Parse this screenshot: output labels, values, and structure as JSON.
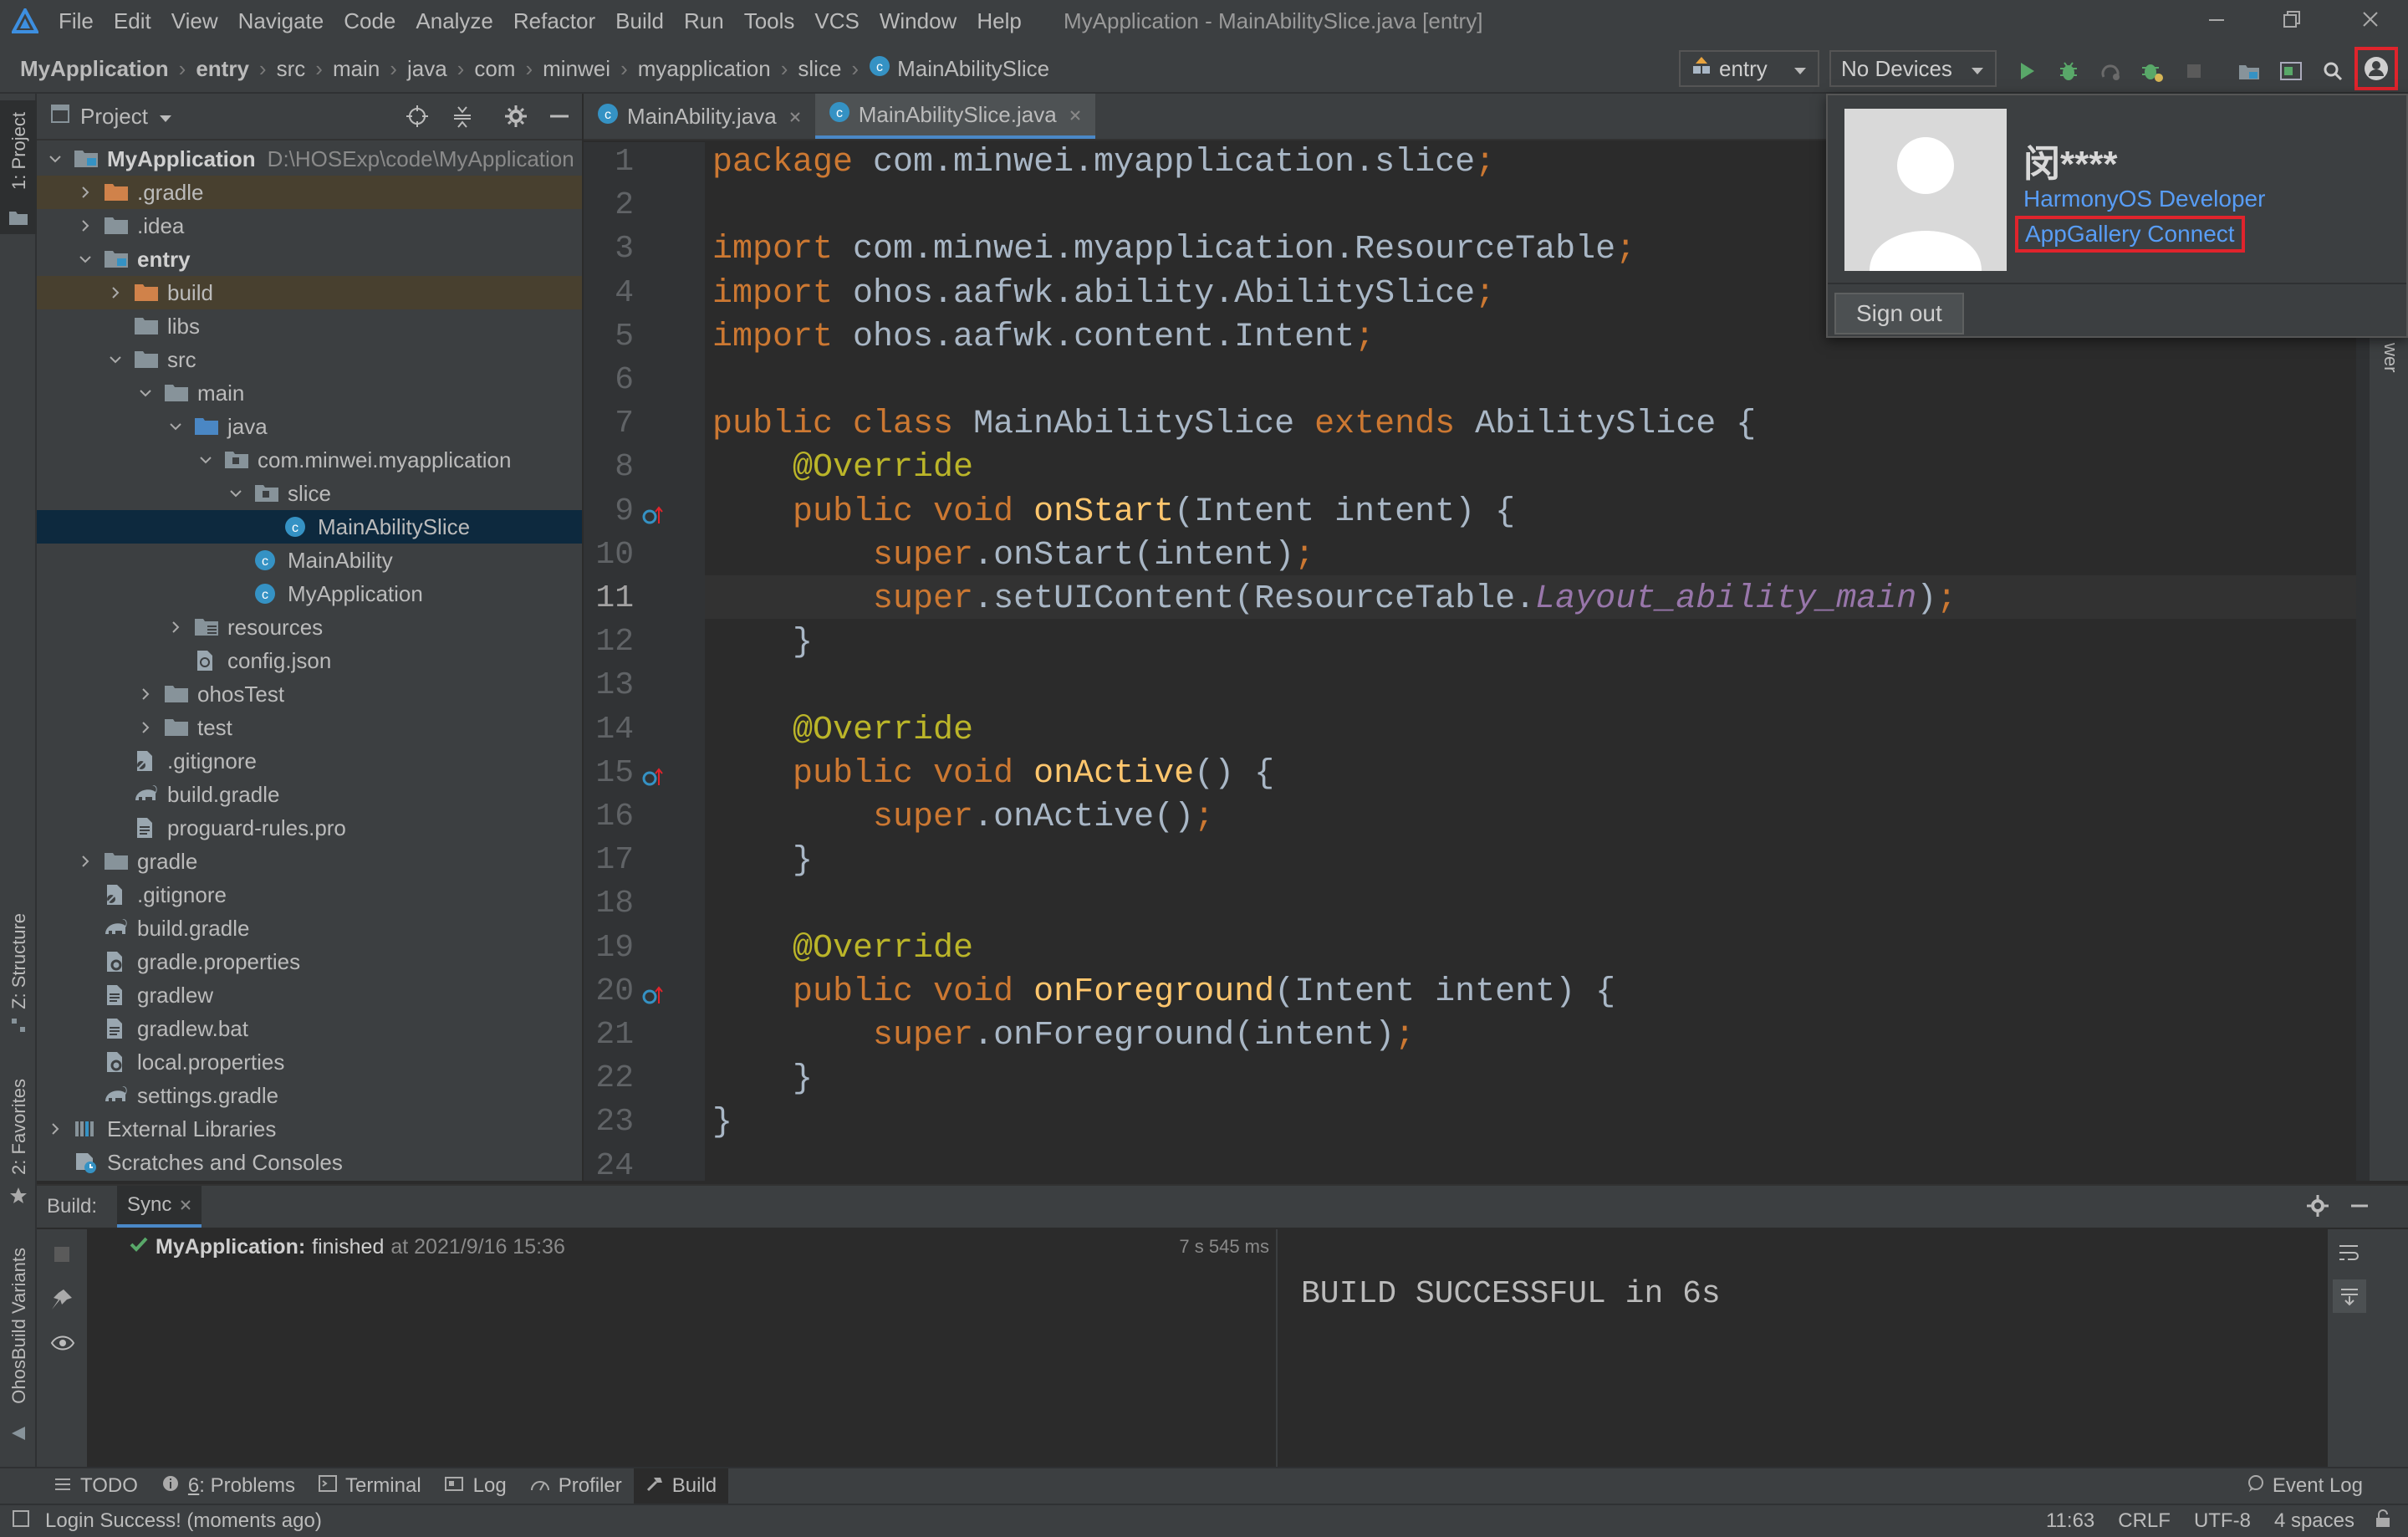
{
  "window": {
    "title": "MyApplication - MainAbilitySlice.java [entry]",
    "menu": [
      "File",
      "Edit",
      "View",
      "Navigate",
      "Code",
      "Analyze",
      "Refactor",
      "Build",
      "Run",
      "Tools",
      "VCS",
      "Window",
      "Help"
    ]
  },
  "breadcrumb": [
    "MyApplication",
    "entry",
    "src",
    "main",
    "java",
    "com",
    "minwei",
    "myapplication",
    "slice",
    "MainAbilitySlice"
  ],
  "toolbar": {
    "module": "entry",
    "device": "No Devices"
  },
  "side_tabs": {
    "project": "1: Project",
    "structure": "Z: Structure",
    "favorites": "2: Favorites",
    "variants": "OhosBuild Variants"
  },
  "project": {
    "title": "Project",
    "tree": [
      {
        "label": "MyApplication",
        "path": "D:\\HOSExp\\code\\MyApplication",
        "bold": true,
        "depth": 0,
        "arrow": "open",
        "icon": "module-folder-icon"
      },
      {
        "label": ".gradle",
        "depth": 1,
        "arrow": "closed",
        "icon": "excluded-folder-icon",
        "hl": true
      },
      {
        "label": ".idea",
        "depth": 1,
        "arrow": "closed",
        "icon": "folder-icon"
      },
      {
        "label": "entry",
        "bold": true,
        "depth": 1,
        "arrow": "open",
        "icon": "module-folder-icon"
      },
      {
        "label": "build",
        "depth": 2,
        "arrow": "closed",
        "icon": "excluded-folder-icon",
        "hl": true
      },
      {
        "label": "libs",
        "depth": 2,
        "arrow": "none",
        "icon": "folder-icon"
      },
      {
        "label": "src",
        "depth": 2,
        "arrow": "open",
        "icon": "folder-icon"
      },
      {
        "label": "main",
        "depth": 3,
        "arrow": "open",
        "icon": "folder-icon"
      },
      {
        "label": "java",
        "depth": 4,
        "arrow": "open",
        "icon": "source-folder-icon"
      },
      {
        "label": "com.minwei.myapplication",
        "depth": 5,
        "arrow": "open",
        "icon": "package-icon"
      },
      {
        "label": "slice",
        "depth": 6,
        "arrow": "open",
        "icon": "package-icon"
      },
      {
        "label": "MainAbilitySlice",
        "depth": 7,
        "arrow": "none",
        "icon": "java-class-icon",
        "sel": true
      },
      {
        "label": "MainAbility",
        "depth": 6,
        "arrow": "none",
        "icon": "java-class-icon"
      },
      {
        "label": "MyApplication",
        "depth": 6,
        "arrow": "none",
        "icon": "java-class-icon"
      },
      {
        "label": "resources",
        "depth": 4,
        "arrow": "closed",
        "icon": "resources-folder-icon"
      },
      {
        "label": "config.json",
        "depth": 4,
        "arrow": "none",
        "icon": "json-file-icon"
      },
      {
        "label": "ohosTest",
        "depth": 3,
        "arrow": "closed",
        "icon": "folder-icon"
      },
      {
        "label": "test",
        "depth": 3,
        "arrow": "closed",
        "icon": "folder-icon"
      },
      {
        "label": ".gitignore",
        "depth": 2,
        "arrow": "none",
        "icon": "gitignore-file-icon"
      },
      {
        "label": "build.gradle",
        "depth": 2,
        "arrow": "none",
        "icon": "gradle-file-icon"
      },
      {
        "label": "proguard-rules.pro",
        "depth": 2,
        "arrow": "none",
        "icon": "text-file-icon"
      },
      {
        "label": "gradle",
        "depth": 1,
        "arrow": "closed",
        "icon": "folder-icon"
      },
      {
        "label": ".gitignore",
        "depth": 1,
        "arrow": "none",
        "icon": "gitignore-file-icon"
      },
      {
        "label": "build.gradle",
        "depth": 1,
        "arrow": "none",
        "icon": "gradle-file-icon"
      },
      {
        "label": "gradle.properties",
        "depth": 1,
        "arrow": "none",
        "icon": "properties-file-icon"
      },
      {
        "label": "gradlew",
        "depth": 1,
        "arrow": "none",
        "icon": "text-file-icon"
      },
      {
        "label": "gradlew.bat",
        "depth": 1,
        "arrow": "none",
        "icon": "text-file-icon"
      },
      {
        "label": "local.properties",
        "depth": 1,
        "arrow": "none",
        "icon": "properties-file-icon"
      },
      {
        "label": "settings.gradle",
        "depth": 1,
        "arrow": "none",
        "icon": "gradle-file-icon"
      },
      {
        "label": "External Libraries",
        "depth": 0,
        "arrow": "closed",
        "icon": "libraries-icon"
      },
      {
        "label": "Scratches and Consoles",
        "depth": 0,
        "arrow": "none",
        "icon": "scratches-icon"
      }
    ]
  },
  "editor": {
    "tabs": [
      {
        "label": "MainAbility.java",
        "active": false
      },
      {
        "label": "MainAbilitySlice.java",
        "active": true
      }
    ],
    "lines": [
      [
        [
          "k",
          "package "
        ],
        [
          "t",
          "com.minwei.myapplication.slice"
        ],
        [
          "k",
          ";"
        ]
      ],
      [],
      [
        [
          "k",
          "import "
        ],
        [
          "t",
          "com.minwei.myapplication.ResourceTable"
        ],
        [
          "k",
          ";"
        ]
      ],
      [
        [
          "k",
          "import "
        ],
        [
          "t",
          "ohos.aafwk.ability.AbilitySlice"
        ],
        [
          "k",
          ";"
        ]
      ],
      [
        [
          "k",
          "import "
        ],
        [
          "t",
          "ohos.aafwk.content.Intent"
        ],
        [
          "k",
          ";"
        ]
      ],
      [],
      [
        [
          "k",
          "public class "
        ],
        [
          "t",
          "MainAbilitySlice "
        ],
        [
          "k",
          "extends "
        ],
        [
          "t",
          "AbilitySlice {"
        ]
      ],
      [
        [
          "t",
          "    "
        ],
        [
          "an",
          "@Override"
        ]
      ],
      [
        [
          "t",
          "    "
        ],
        [
          "k",
          "public void "
        ],
        [
          "fn",
          "onStart"
        ],
        [
          "t",
          "(Intent intent) {"
        ]
      ],
      [
        [
          "t",
          "        "
        ],
        [
          "k",
          "super"
        ],
        [
          "t",
          ".onStart(intent)"
        ],
        [
          "k",
          ";"
        ]
      ],
      [
        [
          "t",
          "        "
        ],
        [
          "k",
          "super"
        ],
        [
          "t",
          ".setUIContent(ResourceTable."
        ],
        [
          "it",
          "Layout_ability_main"
        ],
        [
          "t",
          ")"
        ],
        [
          "k",
          ";"
        ]
      ],
      [
        [
          "t",
          "    }"
        ]
      ],
      [],
      [
        [
          "t",
          "    "
        ],
        [
          "an",
          "@Override"
        ]
      ],
      [
        [
          "t",
          "    "
        ],
        [
          "k",
          "public void "
        ],
        [
          "fn",
          "onActive"
        ],
        [
          "t",
          "() {"
        ]
      ],
      [
        [
          "t",
          "        "
        ],
        [
          "k",
          "super"
        ],
        [
          "t",
          ".onActive()"
        ],
        [
          "k",
          ";"
        ]
      ],
      [
        [
          "t",
          "    }"
        ]
      ],
      [],
      [
        [
          "t",
          "    "
        ],
        [
          "an",
          "@Override"
        ]
      ],
      [
        [
          "t",
          "    "
        ],
        [
          "k",
          "public void "
        ],
        [
          "fn",
          "onForeground"
        ],
        [
          "t",
          "(Intent intent) {"
        ]
      ],
      [
        [
          "t",
          "        "
        ],
        [
          "k",
          "super"
        ],
        [
          "t",
          ".onForeground(intent)"
        ],
        [
          "k",
          ";"
        ]
      ],
      [
        [
          "t",
          "    }"
        ]
      ],
      [
        [
          "t",
          "}"
        ]
      ],
      []
    ],
    "override_lines": [
      9,
      15,
      20
    ],
    "current_line": 11
  },
  "account_popup": {
    "name": "闵****",
    "role_link": "HarmonyOS Developer",
    "agc_link": "AppGallery Connect",
    "sign_out": "Sign out"
  },
  "build": {
    "label": "Build:",
    "tab": "Sync",
    "status_project": "MyApplication:",
    "status_text": "finished",
    "status_time": "at 2021/9/16 15:36",
    "duration": "7 s 545 ms",
    "output": "BUILD SUCCESSFUL in 6s"
  },
  "bottom_tabs": {
    "todo": "TODO",
    "problems_num": "6",
    "problems": ": Problems",
    "terminal": "Terminal",
    "log": "Log",
    "profiler": "Profiler",
    "build": "Build",
    "event_log": "Event Log"
  },
  "status": {
    "message": "Login Success! (moments ago)",
    "position": "11:63",
    "line_sep": "CRLF",
    "encoding": "UTF-8",
    "indent": "4 spaces"
  },
  "colors": {
    "accent": "#4a88c7",
    "highlight_box": "#e0242c",
    "link": "#589df6",
    "success": "#59a869"
  }
}
